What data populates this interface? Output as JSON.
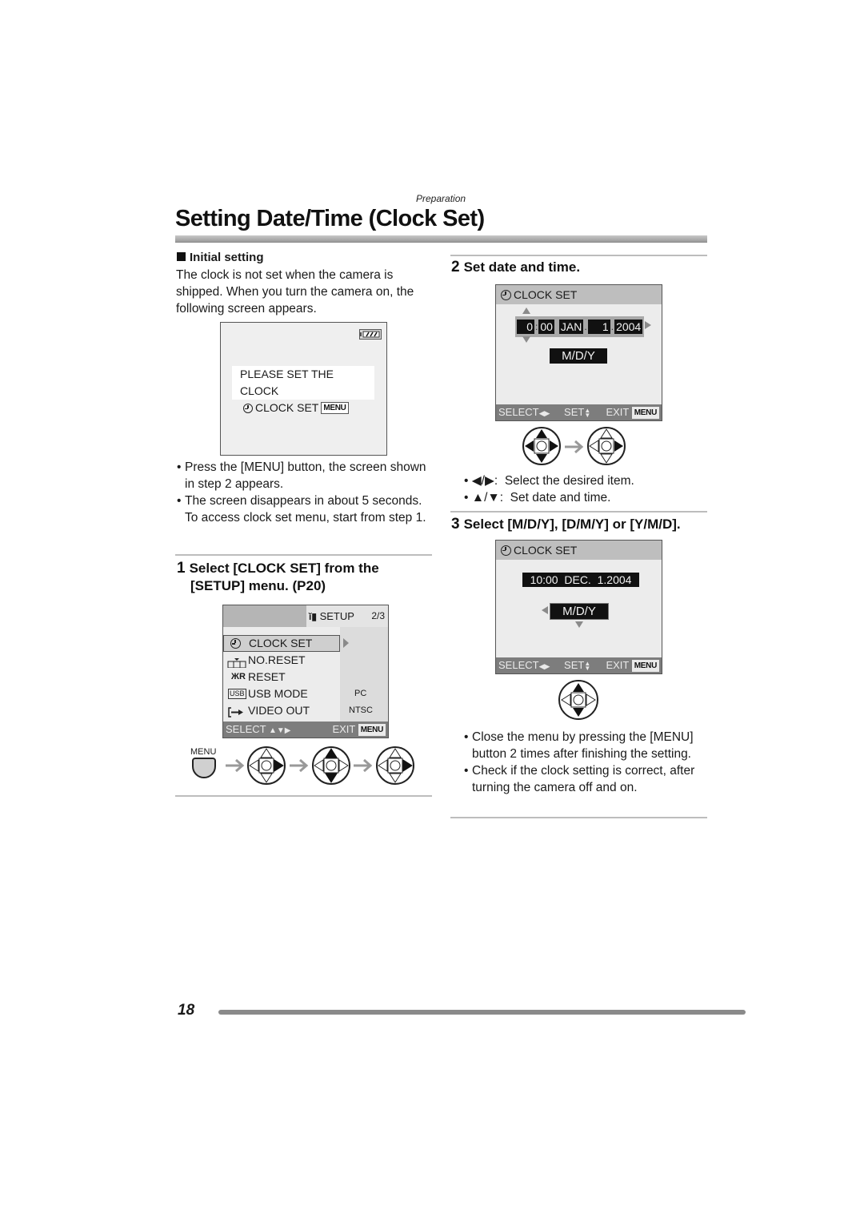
{
  "header": {
    "section": "Preparation",
    "title": "Setting Date/Time (Clock Set)"
  },
  "initial_setting": {
    "heading": "Initial setting",
    "paragraph": "The clock is not set when the camera is shipped. When you turn the camera on, the following screen appears.",
    "screen": {
      "battery_icon": "battery-full-icon",
      "message_line1": "PLEASE SET THE CLOCK",
      "message_line2": "CLOCK SET",
      "menu_badge": "MENU"
    },
    "bullets": [
      "Press the [MENU] button, the screen shown in step 2 appears.",
      "The screen disappears in about 5 seconds. To access clock set menu, start from step 1."
    ]
  },
  "step1": {
    "number": "1",
    "heading_line1": "Select [CLOCK SET] from the",
    "heading_line2": "[SETUP] menu. (P20)",
    "screen": {
      "tab_label": "SETUP",
      "page": "2/3",
      "items": [
        {
          "icon": "clock-icon",
          "label": "CLOCK SET",
          "value": "",
          "selected": true
        },
        {
          "icon": "number-reset-icon",
          "label": "NO.RESET",
          "value": "",
          "selected": false
        },
        {
          "icon": "reset-icon",
          "label": "RESET",
          "value": "",
          "selected": false
        },
        {
          "icon": "usb-icon",
          "label": "USB MODE",
          "value": "PC",
          "selected": false
        },
        {
          "icon": "video-out-icon",
          "label": "VIDEO OUT",
          "value": "NTSC",
          "selected": false
        }
      ],
      "footer_select": "SELECT",
      "footer_exit": "EXIT",
      "menu_badge": "MENU"
    },
    "button_label": "MENU"
  },
  "step2": {
    "number": "2",
    "heading": "Set date and time.",
    "screen": {
      "title": "CLOCK SET",
      "hour": "0",
      "minute": "00",
      "month": "JAN",
      "day": "1",
      "year": "2004",
      "format": "M/D/Y",
      "footer_select": "SELECT",
      "footer_set": "SET",
      "footer_exit": "EXIT",
      "menu_badge": "MENU"
    },
    "bullets": [
      {
        "keys": "◀/▶",
        "text": "Select the desired item."
      },
      {
        "keys": "▲/▼",
        "text": "Set date and time."
      }
    ]
  },
  "step3": {
    "number": "3",
    "heading": "Select [M/D/Y], [D/M/Y] or [Y/M/D].",
    "screen": {
      "title": "CLOCK SET",
      "datetime": "10:00  DEC.  1.2004",
      "format": "M/D/Y",
      "footer_select": "SELECT",
      "footer_set": "SET",
      "footer_exit": "EXIT",
      "menu_badge": "MENU"
    },
    "bullets": [
      "Close the menu by pressing the [MENU] button 2 times after finishing the setting.",
      "Check if the clock setting is correct, after turning the camera off and on."
    ]
  },
  "footer": {
    "page_number": "18"
  }
}
